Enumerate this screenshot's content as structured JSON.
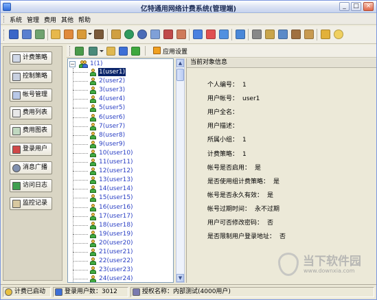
{
  "window": {
    "title": "亿特通用网络计费系统(管理端)"
  },
  "menu": [
    "系统",
    "管理",
    "费用",
    "其他",
    "帮助"
  ],
  "sub_toolbar": {
    "settings_label": "应用设置"
  },
  "nav": [
    "计费策略",
    "控制策略",
    "帐号管理",
    "费用列表",
    "费用图表",
    "登录用户",
    "消息广播",
    "访问日志",
    "监控记录"
  ],
  "tree": {
    "root": "1(1)",
    "items": [
      "1(user1)",
      "2(user2)",
      "3(user3)",
      "4(user4)",
      "5(user5)",
      "6(user6)",
      "7(user7)",
      "8(user8)",
      "9(user9)",
      "10(user10)",
      "11(user11)",
      "12(user12)",
      "13(user13)",
      "14(user14)",
      "15(user15)",
      "16(user16)",
      "17(user17)",
      "18(user18)",
      "19(user19)",
      "20(user20)",
      "21(user21)",
      "22(user22)",
      "23(user23)",
      "24(user24)"
    ],
    "selected_index": 0
  },
  "detail": {
    "header": "当前对象信息",
    "rows": [
      {
        "label": "个人编号：",
        "value": "1"
      },
      {
        "label": "用户帐号：",
        "value": "user1"
      },
      {
        "label": "用户全名：",
        "value": ""
      },
      {
        "label": "用户描述：",
        "value": ""
      },
      {
        "label": "所属小组：",
        "value": "1"
      },
      {
        "label": "计费策略：",
        "value": "1"
      },
      {
        "label": "帐号是否启用：",
        "value": "是"
      },
      {
        "label": "是否使用组计费策略：",
        "value": "是"
      },
      {
        "label": "帐号是否永久有效：",
        "value": "是"
      },
      {
        "label": "帐号过期时间：",
        "value": "永不过期"
      },
      {
        "label": "用户可否修改密码：",
        "value": "否"
      },
      {
        "label": "是否限制用户登录地址：",
        "value": "否"
      }
    ]
  },
  "status": {
    "billing": "计费已启动",
    "logged_users": "登录用户数：3012",
    "license": "授权名称：内部测试(4000用户)"
  },
  "watermark": {
    "name": "当下软件园",
    "url": "www.downxia.com"
  },
  "colors": {
    "selection": "#0a246a",
    "tree_text": "#2a3fc4",
    "window_bg": "#ece9d8"
  }
}
